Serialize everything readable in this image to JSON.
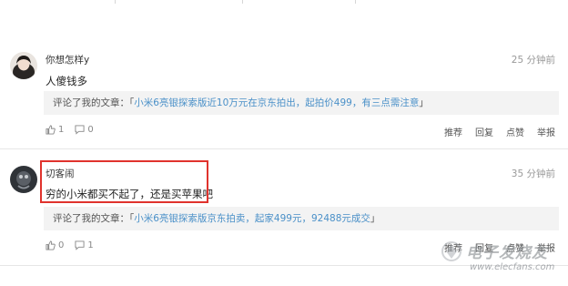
{
  "comments": [
    {
      "username": "你想怎样y",
      "time": "25 分钟前",
      "body": "人傻钱多",
      "quote": {
        "prefix": "评论了我的文章：",
        "open_bracket": "「",
        "title": "小米6亮银探索版近10万元在京东拍出，起拍价499，有三点需注意",
        "close_bracket": "」"
      },
      "likes": "1",
      "replies": "0",
      "actions": [
        "推荐",
        "回复",
        "点赞",
        "举报"
      ]
    },
    {
      "username": "切客闹",
      "time": "35 分钟前",
      "body": "穷的小米都买不起了，还是买苹果吧",
      "quote": {
        "prefix": "评论了我的文章：",
        "open_bracket": "「",
        "title": "小米6亮银探索版京东拍卖，起家499元，92488元成交",
        "close_bracket": "」"
      },
      "likes": "0",
      "replies": "1",
      "actions": [
        "推荐",
        "回复",
        "点赞",
        "举报"
      ]
    }
  ],
  "watermark": {
    "brand": "电子发烧友",
    "url": "www.elecfans.com"
  },
  "colors": {
    "link": "#4a90c8",
    "highlight": "#e0332d",
    "quote_bg": "#f3f3f3"
  }
}
